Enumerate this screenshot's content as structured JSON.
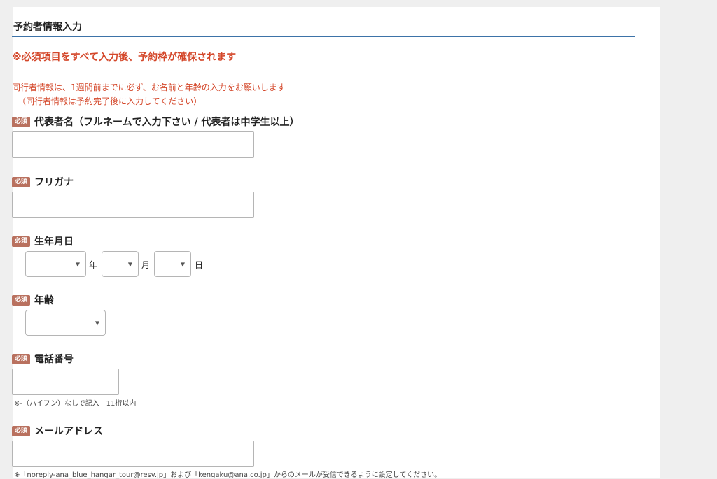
{
  "section": {
    "title": "予約者情報入力",
    "notice": "※必須項目をすべて入力後、予約枠が確保されます",
    "note_line1": "同行者情報は、1週間前までに必ず、お名前と年齢の入力をお願いします",
    "note_line2": "（同行者情報は予約完了後に入力してください）"
  },
  "required_badge": "必須",
  "fields": {
    "name": {
      "label": "代表者名（フルネームで入力下さい / 代表者は中学生以上）",
      "value": "",
      "placeholder": ""
    },
    "furigana": {
      "label": "フリガナ",
      "value": "",
      "placeholder": ""
    },
    "birthdate": {
      "label": "生年月日",
      "year_unit": "年",
      "month_unit": "月",
      "day_unit": "日",
      "year_value": "",
      "month_value": "",
      "day_value": ""
    },
    "age": {
      "label": "年齢",
      "value": ""
    },
    "phone": {
      "label": "電話番号",
      "value": "",
      "hint": "※-（ハイフン）なしで記入　11桁以内"
    },
    "email": {
      "label": "メールアドレス",
      "value": "",
      "hint": "※「noreply-ana_blue_hangar_tour@resv.jp」および「kengaku@ana.co.jp」からのメールが受信できるように設定してください。"
    }
  },
  "icons": {
    "dropdown": "chevron-down-icon"
  },
  "colors": {
    "accent_red": "#d4472a",
    "rule_blue": "#3d73a8",
    "badge": "#b9715f"
  }
}
